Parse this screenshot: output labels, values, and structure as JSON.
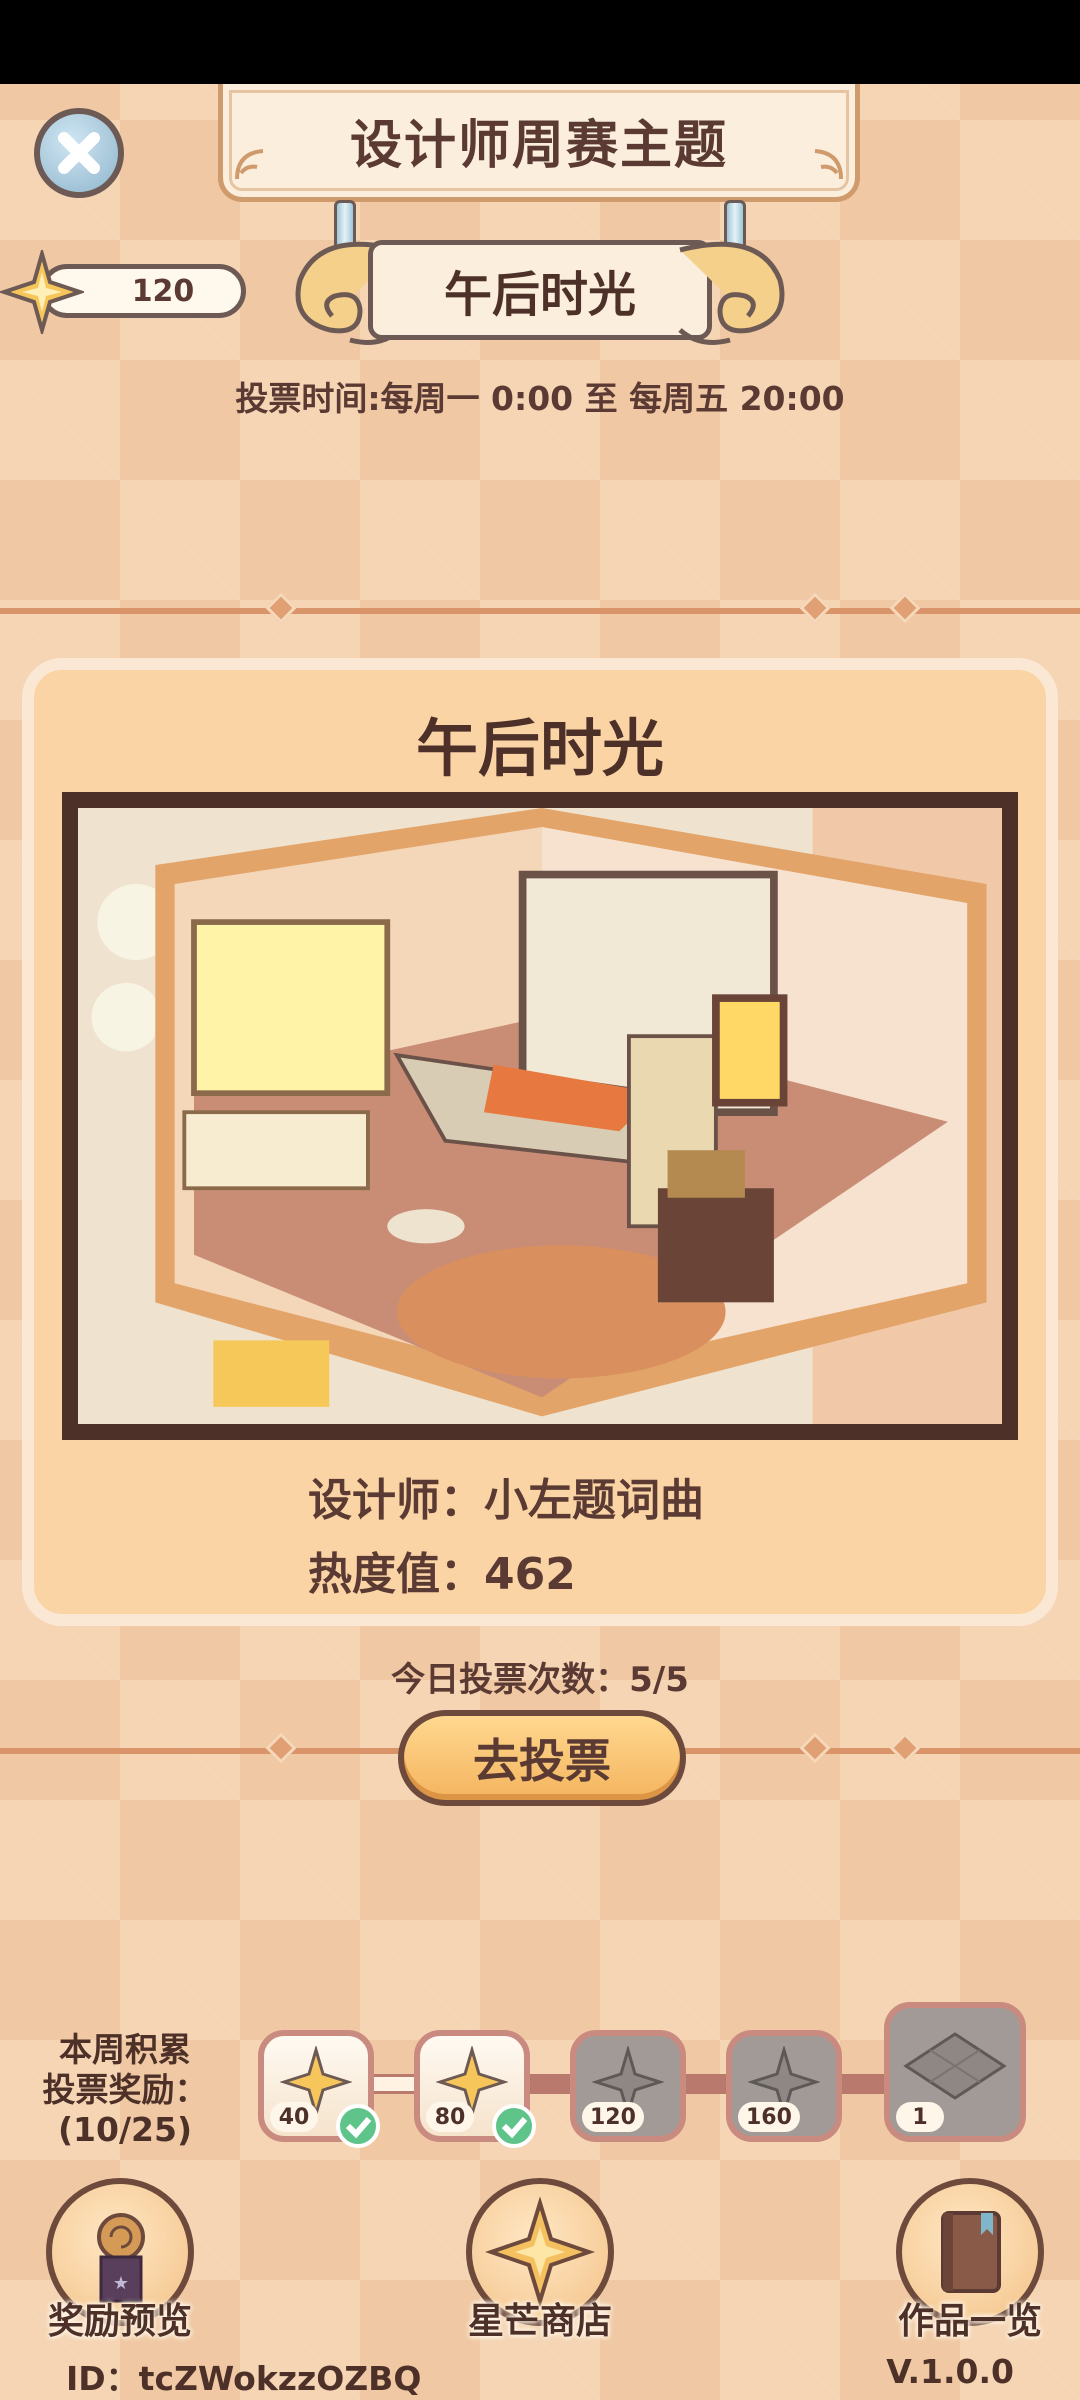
{
  "header": {
    "title": "设计师周赛主题",
    "theme_name": "午后时光",
    "vote_time": "投票时间:每周一  0:00  至  每周五  20:00",
    "close_icon": "close-icon"
  },
  "currency": {
    "icon": "star-icon",
    "amount": "120"
  },
  "entry": {
    "title": "午后时光",
    "designer": "设计师：小左题词曲",
    "heat": "热度值：462"
  },
  "voting": {
    "today_votes": "今日投票次数：5/5",
    "vote_button": "去投票"
  },
  "weekly_reward": {
    "label_line1": "本周积累",
    "label_line2": "投票奖励：",
    "label_line3": "(10/25)",
    "milestones": [
      {
        "value": "40",
        "claimed": true
      },
      {
        "value": "80",
        "claimed": true
      },
      {
        "value": "120",
        "claimed": false
      },
      {
        "value": "160",
        "claimed": false
      },
      {
        "value": "1",
        "claimed": false,
        "item": "floor-tile"
      }
    ]
  },
  "nav": {
    "reward_preview": "奖励预览",
    "star_shop": "星芒商店",
    "works_list": "作品一览"
  },
  "footer": {
    "user_id": "ID：tcZWokzzOZBQ",
    "version": "V.1.0.0"
  },
  "colors": {
    "background": "#f0c9a4",
    "card": "#fbd4a6",
    "button": "#f4b45e",
    "text": "#5a3a32"
  }
}
